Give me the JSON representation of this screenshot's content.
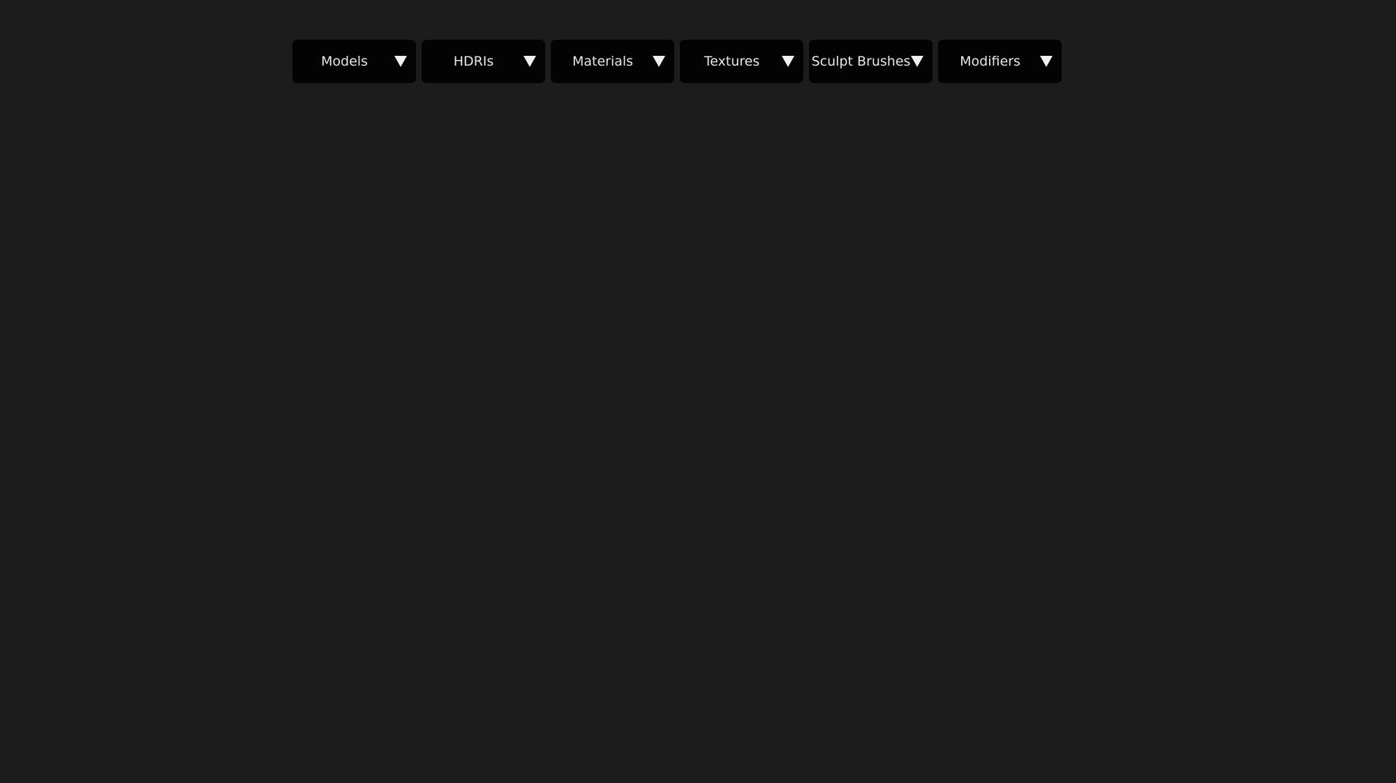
{
  "menubar": {
    "items": [
      {
        "label": "Models",
        "icon": "triangle-down-icon"
      },
      {
        "label": "HDRIs",
        "icon": "triangle-down-icon"
      },
      {
        "label": "Materials",
        "icon": "triangle-down-icon"
      },
      {
        "label": "Textures",
        "icon": "triangle-down-icon"
      },
      {
        "label": "Sculpt Brushes",
        "icon": "triangle-down-icon"
      },
      {
        "label": "Modifiers",
        "icon": "triangle-down-icon"
      }
    ]
  },
  "colors": {
    "background": "#1c1c1c",
    "button_background": "#030303",
    "text": "#e8e8e8"
  }
}
